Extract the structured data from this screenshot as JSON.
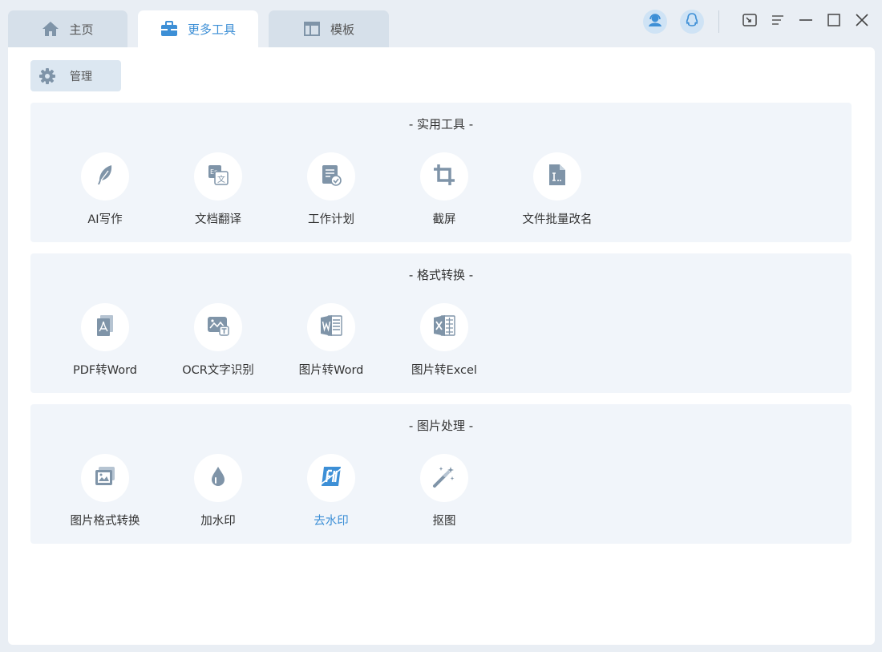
{
  "tabs": [
    {
      "label": "主页",
      "icon": "home-icon"
    },
    {
      "label": "更多工具",
      "icon": "briefcase-icon",
      "active": true
    },
    {
      "label": "模板",
      "icon": "template-icon"
    }
  ],
  "toolbar": {
    "manage_label": "管理"
  },
  "sections": [
    {
      "title": "- 实用工具 -",
      "tools": [
        {
          "label": "AI写作",
          "icon": "feather-icon"
        },
        {
          "label": "文档翻译",
          "icon": "translate-icon"
        },
        {
          "label": "工作计划",
          "icon": "plan-checklist-icon"
        },
        {
          "label": "截屏",
          "icon": "crop-icon"
        },
        {
          "label": "文件批量改名",
          "icon": "file-rename-icon"
        }
      ]
    },
    {
      "title": "- 格式转换 -",
      "tools": [
        {
          "label": "PDF转Word",
          "icon": "pdf-icon"
        },
        {
          "label": "OCR文字识别",
          "icon": "ocr-image-text-icon"
        },
        {
          "label": "图片转Word",
          "icon": "word-icon"
        },
        {
          "label": "图片转Excel",
          "icon": "excel-icon"
        }
      ]
    },
    {
      "title": "- 图片处理 -",
      "tools": [
        {
          "label": "图片格式转换",
          "icon": "image-convert-icon"
        },
        {
          "label": "加水印",
          "icon": "water-drop-icon"
        },
        {
          "label": "去水印",
          "icon": "remove-watermark-icon",
          "active": true
        },
        {
          "label": "抠图",
          "icon": "magic-wand-icon"
        }
      ]
    }
  ],
  "colors": {
    "accent": "#3d8fd6",
    "icon_gray": "#7f94a8",
    "panel_bg": "#f1f5fa",
    "window_bg": "#e9eef4"
  }
}
